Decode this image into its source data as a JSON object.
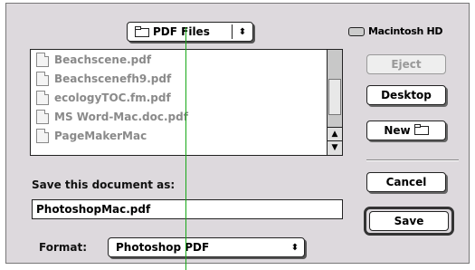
{
  "folder_popup": {
    "label": "PDF Files",
    "icon": "folder-icon",
    "stepper": "⬍"
  },
  "volume": {
    "label": "Macintosh HD",
    "icon": "hard-disk-icon"
  },
  "files": [
    {
      "name": "Beachscene.pdf"
    },
    {
      "name": "Beachscenefh9.pdf"
    },
    {
      "name": "ecologyTOC.fm.pdf"
    },
    {
      "name": "MS Word-Mac.doc.pdf"
    },
    {
      "name": "PageMakerMac"
    }
  ],
  "buttons": {
    "eject": "Eject",
    "desktop": "Desktop",
    "new": "New",
    "cancel": "Cancel",
    "save": "Save"
  },
  "save_prompt": "Save this document as:",
  "filename_value": "PhotoshopMac.pdf",
  "format": {
    "label": "Format:",
    "value": "Photoshop PDF"
  },
  "colors": {
    "dialog_bg": "#ddd9dd",
    "guide_line": "#18a818",
    "disabled_text": "#999999"
  }
}
